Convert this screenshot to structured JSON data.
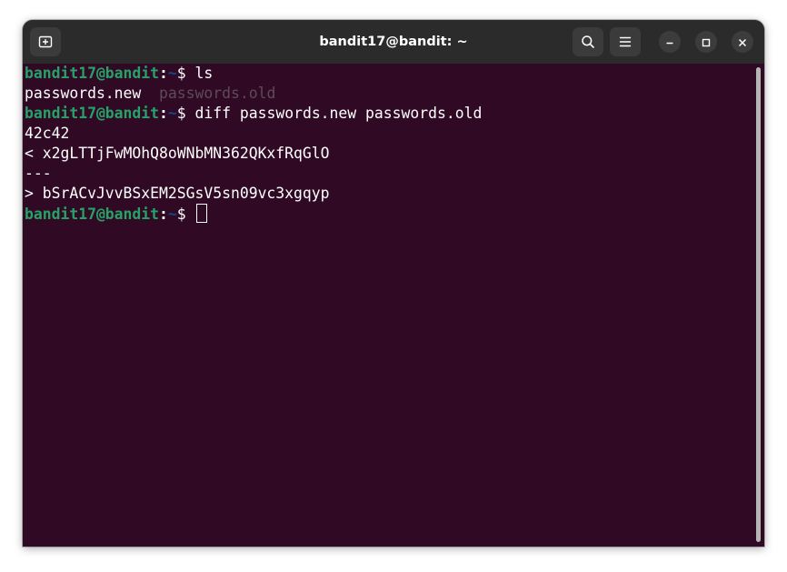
{
  "window": {
    "title": "bandit17@bandit: ~"
  },
  "titlebar": {
    "new_tab_icon": "new-tab-icon",
    "search_icon": "search-icon",
    "menu_icon": "hamburger-menu-icon",
    "minimize_icon": "minimize-icon",
    "maximize_icon": "maximize-icon",
    "close_icon": "close-icon"
  },
  "prompt": {
    "user_host": "bandit17@bandit",
    "colon": ":",
    "path": "~",
    "symbol": "$ "
  },
  "terminal": {
    "lines": [
      {
        "type": "command",
        "command": "ls"
      },
      {
        "type": "ls-output",
        "items": [
          "passwords.new",
          "passwords.old"
        ]
      },
      {
        "type": "command",
        "command": "diff passwords.new passwords.old"
      },
      {
        "type": "output",
        "text": "42c42"
      },
      {
        "type": "output",
        "text": "< x2gLTTjFwMOhQ8oWNbMN362QKxfRqGlO"
      },
      {
        "type": "output",
        "text": "---"
      },
      {
        "type": "output",
        "text": "> bSrACvJvvBSxEM2SGsV5sn09vc3xgqyp"
      },
      {
        "type": "command",
        "command": ""
      }
    ]
  },
  "colors": {
    "terminal_bg": "#300a24",
    "prompt_user": "#26a269",
    "prompt_path": "#12488b",
    "titlebar_bg": "#2b2b2b"
  }
}
